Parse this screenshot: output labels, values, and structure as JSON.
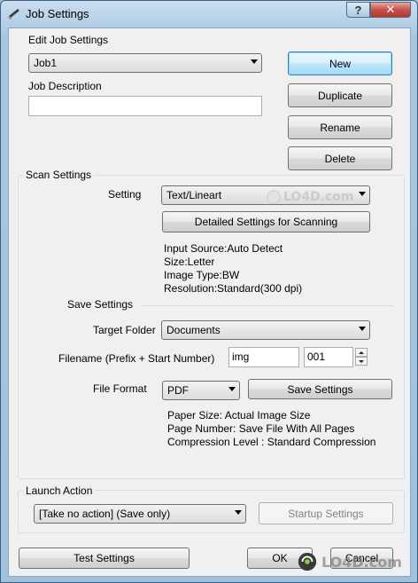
{
  "window": {
    "title": "Job Settings",
    "help_glyph": "?",
    "close_glyph": "✕"
  },
  "job": {
    "section_label": "Edit Job Settings",
    "selected_job": "Job1",
    "description_label": "Job Description",
    "description_value": "",
    "buttons": {
      "new": "New",
      "duplicate": "Duplicate",
      "rename": "Rename",
      "delete": "Delete"
    }
  },
  "scan": {
    "group_label": "Scan Settings",
    "setting_label": "Setting",
    "setting_value": "Text/Lineart",
    "detailed_button": "Detailed Settings for Scanning",
    "info": [
      "Input Source:Auto Detect",
      "Size:Letter",
      "Image Type:BW",
      "Resolution:Standard(300 dpi)"
    ]
  },
  "save": {
    "section_label": "Save Settings",
    "target_folder_label": "Target Folder",
    "target_folder_value": "Documents",
    "filename_label": "Filename (Prefix + Start Number)",
    "prefix_value": "img",
    "start_number_value": "001",
    "file_format_label": "File Format",
    "file_format_value": "PDF",
    "save_settings_button": "Save Settings",
    "info": [
      "Paper Size: Actual Image Size",
      "Page Number: Save File With All Pages",
      "Compression Level : Standard Compression"
    ]
  },
  "launch": {
    "group_label": "Launch Action",
    "action_value": "[Take no action] (Save only)",
    "startup_button": "Startup Settings"
  },
  "footer": {
    "test_button": "Test Settings",
    "ok_button": "OK",
    "cancel_button": "Cancel"
  },
  "watermark": {
    "text": "LO4D.com"
  }
}
